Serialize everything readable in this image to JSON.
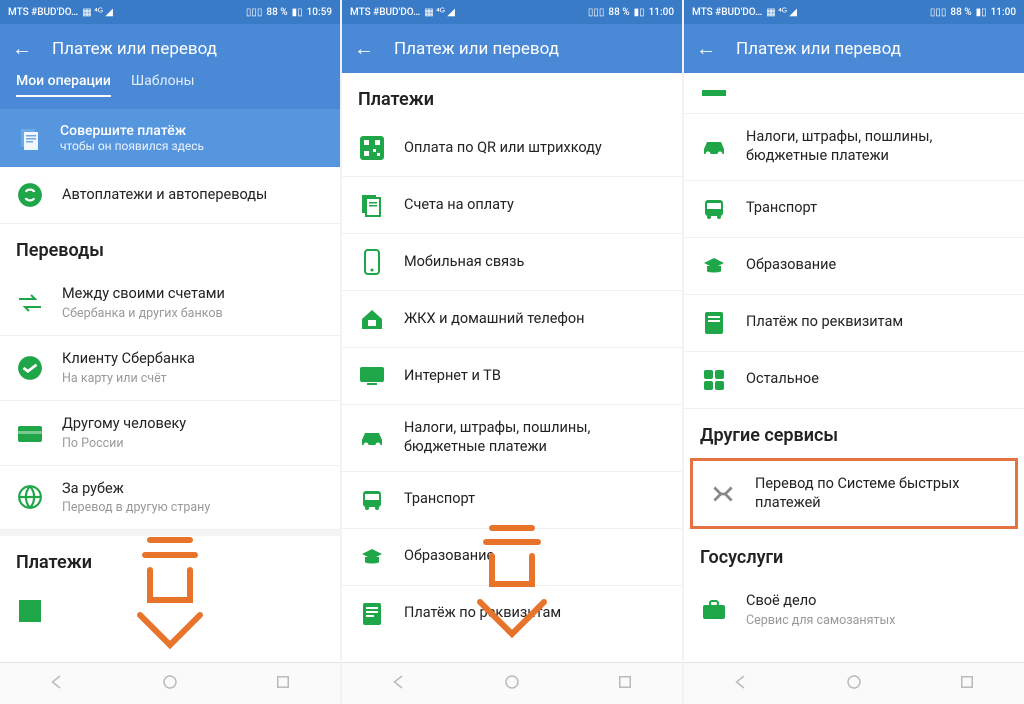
{
  "statusbar": {
    "carrier": "MTS #BUD'DO…",
    "signal_icons": "▦ ⁴ᴳ ◢",
    "vibrate": "▯▯▯",
    "battery_pct_1": "88 %",
    "time_1": "10:59",
    "time_2": "11:00",
    "time_3": "11:00"
  },
  "header": {
    "title": "Платеж или перевод"
  },
  "tabs": {
    "my_ops": "Мои операции",
    "templates": "Шаблоны"
  },
  "promo": {
    "title": "Совершите платёж",
    "sub": "чтобы он появился здесь"
  },
  "screen1": {
    "autopay": "Автоплатежи и автопереводы",
    "transfers_heading": "Переводы",
    "r1t": "Между своими счетами",
    "r1s": "Сбербанка и других банков",
    "r2t": "Клиенту Сбербанка",
    "r2s": "На карту или счёт",
    "r3t": "Другому человеку",
    "r3s": "По России",
    "r4t": "За рубеж",
    "r4s": "Перевод в другую страну",
    "payments_heading": "Платежи"
  },
  "screen2": {
    "heading": "Платежи",
    "rows": [
      "Оплата по QR или штрихкоду",
      "Счета на оплату",
      "Мобильная связь",
      "ЖКХ и домашний телефон",
      "Интернет и ТВ",
      "Налоги, штрафы, пошлины, бюджетные платежи",
      "Транспорт",
      "Образование",
      "Платёж по реквизитам"
    ]
  },
  "screen3": {
    "rows_top": [
      "Налоги, штрафы, пошлины, бюджетные платежи",
      "Транспорт",
      "Образование",
      "Платёж по реквизитам",
      "Остальное"
    ],
    "other_heading": "Другие сервисы",
    "sbp": "Перевод по Системе быстрых платежей",
    "gos_heading": "Госуслуги",
    "gos_t": "Своё дело",
    "gos_s": "Сервис для самозанятых"
  }
}
